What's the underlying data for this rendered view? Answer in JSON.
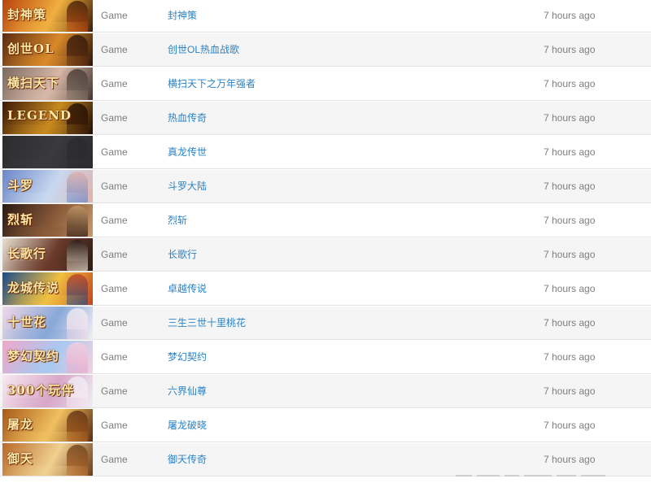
{
  "rows": [
    {
      "category": "Game",
      "title": "封神策",
      "time": "7 hours ago",
      "thumb_text": "封神策",
      "colors": [
        "#b8420b",
        "#f0b040",
        "#3a1a05"
      ]
    },
    {
      "category": "Game",
      "title": "创世OL热血战歌",
      "time": "7 hours ago",
      "thumb_text": "创世OL",
      "colors": [
        "#5a2a10",
        "#d98a2a",
        "#2a1208"
      ]
    },
    {
      "category": "Game",
      "title": "横扫天下之万年强者",
      "time": "7 hours ago",
      "thumb_text": "横扫天下",
      "colors": [
        "#7a6a60",
        "#d8b8a8",
        "#40342e"
      ]
    },
    {
      "category": "Game",
      "title": "热血传奇",
      "time": "7 hours ago",
      "thumb_text": "LEGEND",
      "colors": [
        "#3a1806",
        "#c88a20",
        "#1a0a02"
      ]
    },
    {
      "category": "Game",
      "title": "真龙传世",
      "time": "7 hours ago",
      "thumb_text": "",
      "colors": [
        "#2c2c2e",
        "#3a3a3c",
        "#2a2a2c"
      ]
    },
    {
      "category": "Game",
      "title": "斗罗大陆",
      "time": "7 hours ago",
      "thumb_text": "斗罗",
      "colors": [
        "#6a86c8",
        "#c8d8f0",
        "#e0b0a8"
      ]
    },
    {
      "category": "Game",
      "title": "烈斩",
      "time": "7 hours ago",
      "thumb_text": "烈斩",
      "colors": [
        "#2a1a12",
        "#8a5a3a",
        "#c89a6a"
      ]
    },
    {
      "category": "Game",
      "title": "长歌行",
      "time": "7 hours ago",
      "thumb_text": "长歌行",
      "colors": [
        "#e8e0d0",
        "#6a3a2a",
        "#2a1a14"
      ]
    },
    {
      "category": "Game",
      "title": "卓越传说",
      "time": "7 hours ago",
      "thumb_text": "龙城传说",
      "colors": [
        "#1a4a8a",
        "#f0c040",
        "#c04020"
      ]
    },
    {
      "category": "Game",
      "title": "三生三世十里桃花",
      "time": "7 hours ago",
      "thumb_text": "十世花",
      "colors": [
        "#f0d8e8",
        "#88a8d8",
        "#f4f0f4"
      ]
    },
    {
      "category": "Game",
      "title": "梦幻契约",
      "time": "7 hours ago",
      "thumb_text": "梦幻契约",
      "colors": [
        "#f0a8c8",
        "#a8c8f0",
        "#f4d0e0"
      ]
    },
    {
      "category": "Game",
      "title": "六界仙尊",
      "time": "7 hours ago",
      "thumb_text": "300个玩伴",
      "colors": [
        "#f8e8f0",
        "#d8a8c8",
        "#f0f0f8"
      ]
    },
    {
      "category": "Game",
      "title": "屠龙破晓",
      "time": "7 hours ago",
      "thumb_text": "屠龙",
      "colors": [
        "#a85a18",
        "#f0c060",
        "#5a2a10"
      ]
    },
    {
      "category": "Game",
      "title": "御天传奇",
      "time": "7 hours ago",
      "thumb_text": "御天",
      "colors": [
        "#b86a28",
        "#f0d090",
        "#6a3a18"
      ]
    }
  ]
}
